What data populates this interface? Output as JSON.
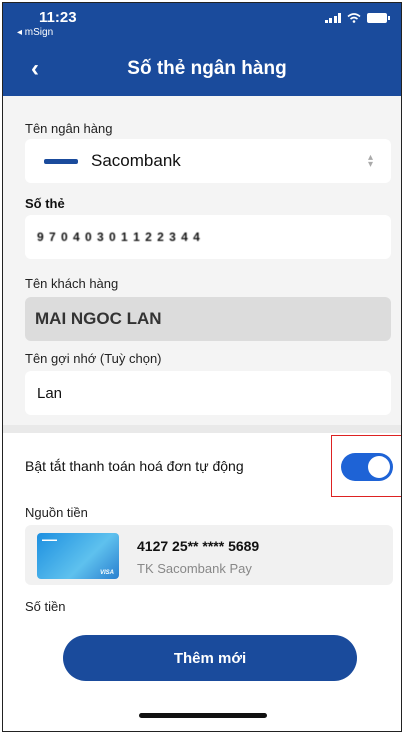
{
  "status_bar": {
    "time": "11:23",
    "back_app": "◂ mSign"
  },
  "header": {
    "back_glyph": "‹",
    "title": "Số thẻ ngân hàng"
  },
  "form": {
    "bank_label": "Tên ngân hàng",
    "bank_value": "Sacombank",
    "card_label": "Số thẻ",
    "card_value": "9 7 0 4 0 3 0 1 1 2 2 3 4 4",
    "customer_label": "Tên khách hàng",
    "customer_value": "MAI NGOC LAN",
    "nickname_label": "Tên gợi nhớ (Tuỳ chọn)",
    "nickname_value": "Lan"
  },
  "auto_pay": {
    "label": "Bật tắt thanh toán hoá đơn tự động",
    "enabled": true
  },
  "funding": {
    "label": "Nguồn tiền",
    "card_number": "4127 25** **** 5689",
    "card_name": "TK Sacombank Pay"
  },
  "amount": {
    "label": "Số tiền"
  },
  "actions": {
    "submit_label": "Thêm mới"
  },
  "colors": {
    "primary": "#1a4b9c",
    "toggle_on": "#1e63d6",
    "highlight": "#dd2222"
  }
}
